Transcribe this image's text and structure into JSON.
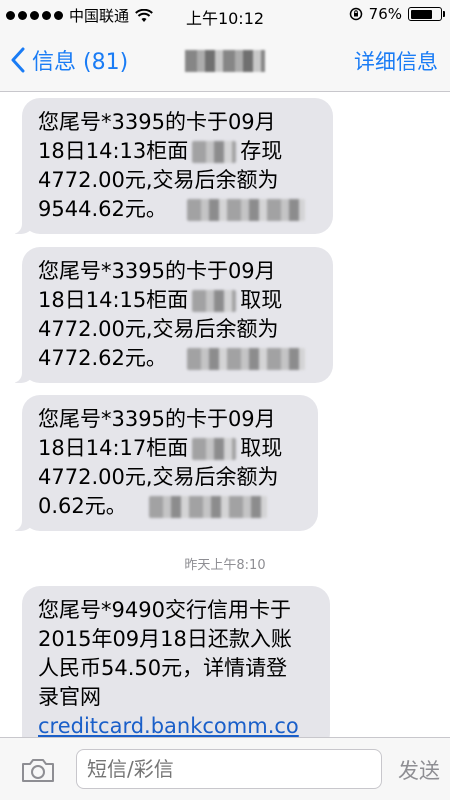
{
  "status_bar": {
    "carrier": "中国联通",
    "time": "上午10:12",
    "battery_text": "76%",
    "battery_level": 0.76
  },
  "nav": {
    "back_label": "信息 (81)",
    "detail_label": "详细信息"
  },
  "messages": [
    {
      "lines": [
        "您尾号*3395的卡于09月",
        "18日14:13柜面",
        "4772.00元,交易后余额为",
        "9544.62元。"
      ],
      "action": "存现"
    },
    {
      "lines": [
        "您尾号*3395的卡于09月",
        "18日14:15柜面",
        "4772.00元,交易后余额为",
        "4772.62元。"
      ],
      "action": "取现"
    },
    {
      "lines": [
        "您尾号*3395的卡于09月",
        "18日14:17柜面",
        "4772.00元,交易后余额为",
        "0.62元。"
      ],
      "action": "取现"
    }
  ],
  "timestamp": "昨天上午8:10",
  "last_message": {
    "lines": [
      "您尾号*9490交行信用卡于",
      "2015年09月18日还款入账",
      "人民币54.50元，详情请登",
      "录官网"
    ],
    "link": "creditcard.bankcomm.co"
  },
  "input": {
    "placeholder": "短信/彩信",
    "send_label": "发送"
  },
  "icons": {
    "back": "chevron-left-icon",
    "camera": "camera-icon",
    "wifi": "wifi-icon",
    "lock": "rotation-lock-icon"
  },
  "colors": {
    "accent": "#1a7cf5",
    "bubble": "#e5e5ea",
    "link": "#1a5fc9"
  }
}
